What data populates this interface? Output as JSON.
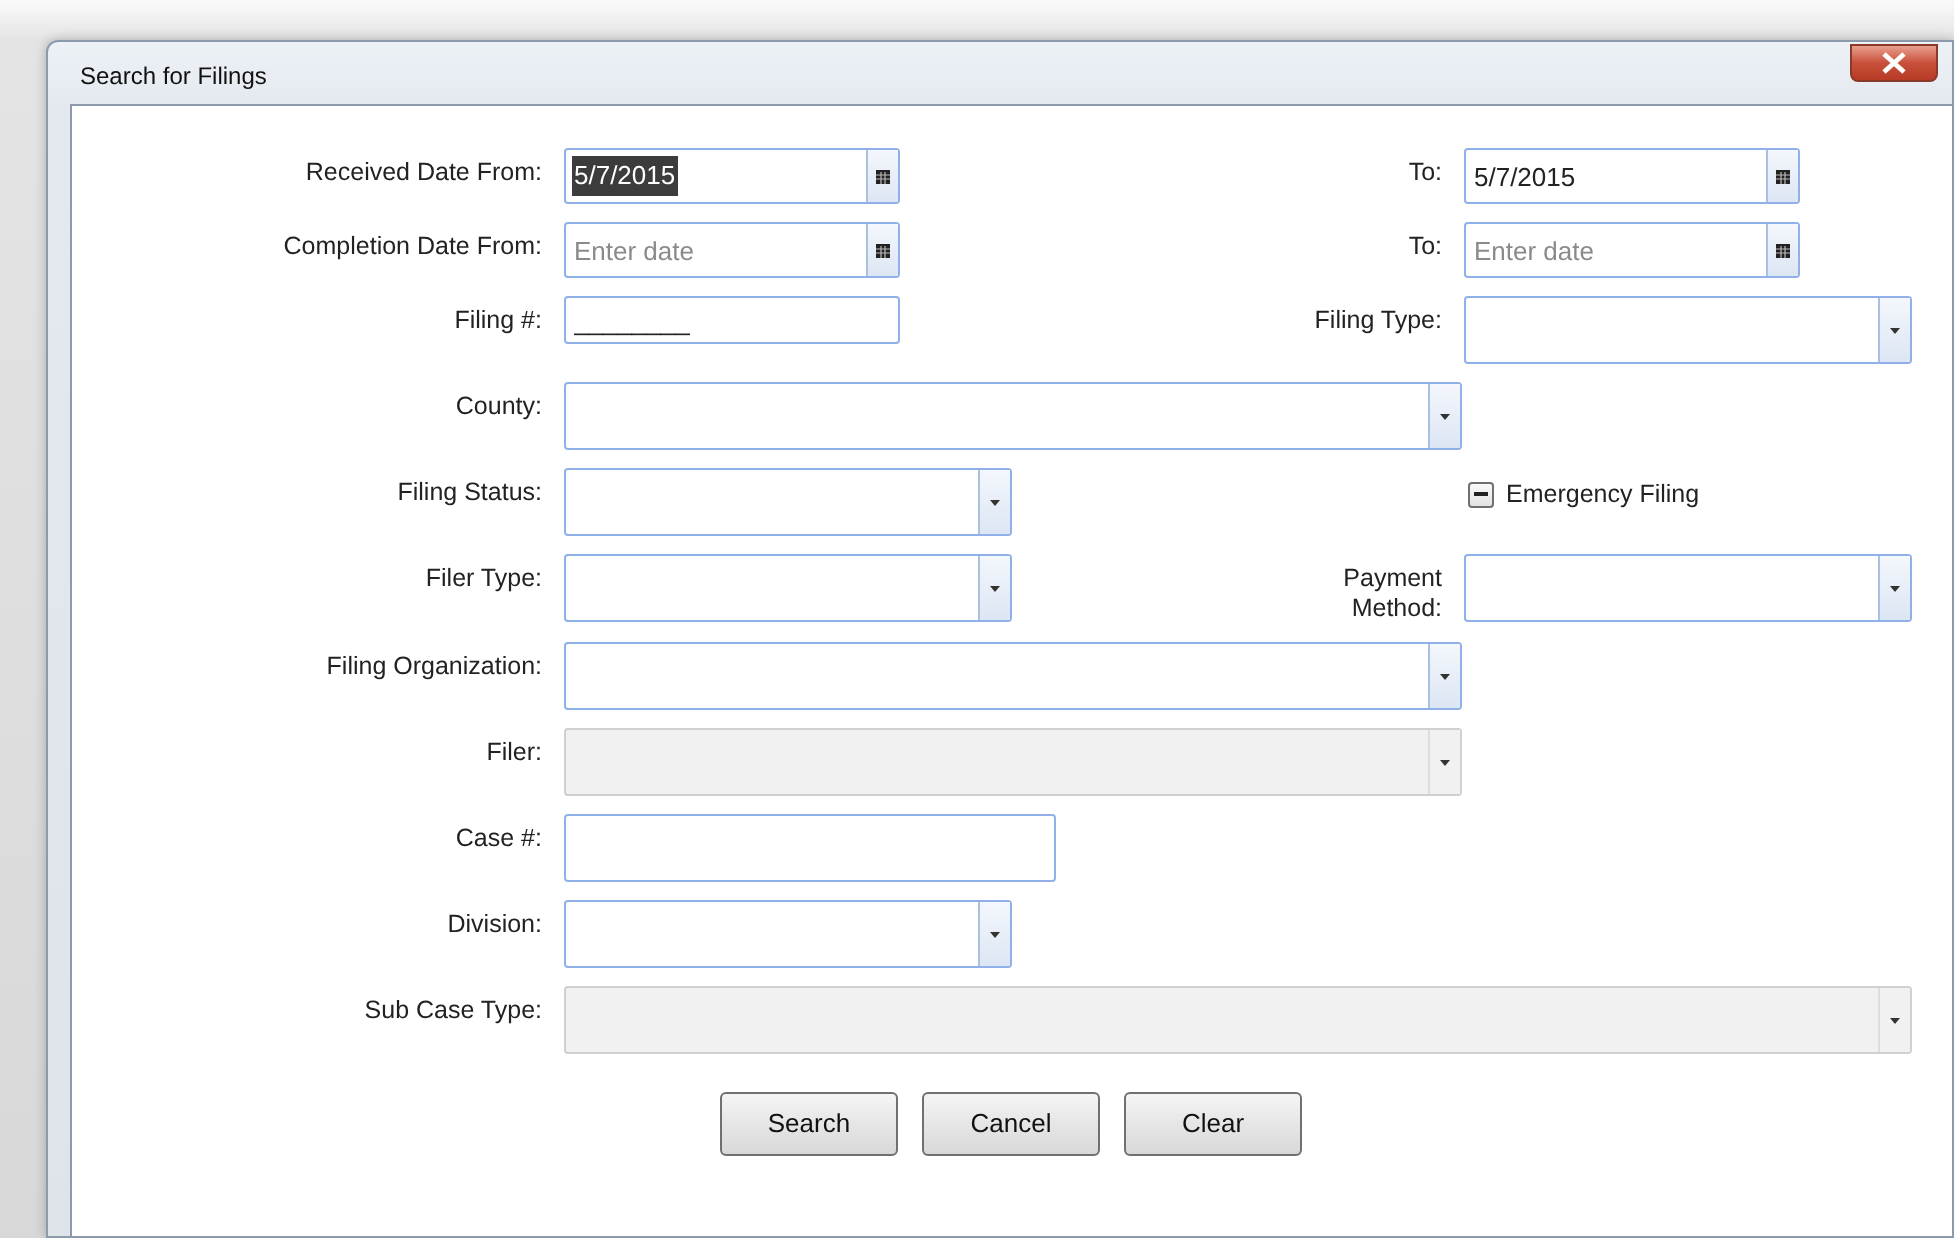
{
  "window": {
    "title": "Search for Filings"
  },
  "rows": [
    {
      "fields": [
        {
          "label": "Received Date From:",
          "kind": "date",
          "value": "5/7/2015",
          "text_selected": true,
          "disabled": false
        },
        {
          "label": "To:",
          "kind": "date",
          "value": "5/7/2015",
          "text_selected": false,
          "disabled": false
        }
      ]
    },
    {
      "fields": [
        {
          "label": "Completion Date From:",
          "kind": "date",
          "placeholder": "Enter date",
          "text_selected": false,
          "disabled": false
        },
        {
          "label": "To:",
          "kind": "date",
          "placeholder": "Enter date",
          "text_selected": false,
          "disabled": false
        }
      ]
    },
    {
      "fields": [
        {
          "label": "Filing #:",
          "kind": "text",
          "value": "________",
          "disabled": false
        },
        {
          "label": "Filing Type:",
          "kind": "combo",
          "disabled": false
        }
      ]
    },
    {
      "fields": [
        {
          "label": "County:",
          "kind": "combo",
          "disabled": false
        }
      ]
    },
    {
      "fields": [
        {
          "label": "Filing Status:",
          "kind": "combo",
          "disabled": false
        },
        {
          "label": "Emergency Filing",
          "kind": "checkbox",
          "indeterminate": true
        }
      ]
    },
    {
      "fields": [
        {
          "label": "Filer Type:",
          "kind": "combo",
          "disabled": false
        },
        {
          "label": "Payment Method:",
          "kind": "combo",
          "disabled": false
        }
      ]
    },
    {
      "fields": [
        {
          "label": "Filing Organization:",
          "kind": "combo",
          "disabled": false
        }
      ]
    },
    {
      "fields": [
        {
          "label": "Filer:",
          "kind": "combo",
          "disabled": true
        }
      ]
    },
    {
      "fields": [
        {
          "label": "Case #:",
          "kind": "text",
          "disabled": false
        }
      ]
    },
    {
      "fields": [
        {
          "label": "Division:",
          "kind": "combo",
          "disabled": false
        }
      ]
    },
    {
      "fields": [
        {
          "label": "Sub Case Type:",
          "kind": "combo",
          "disabled": true
        }
      ]
    }
  ],
  "buttons": [
    "Search",
    "Cancel",
    "Clear"
  ]
}
